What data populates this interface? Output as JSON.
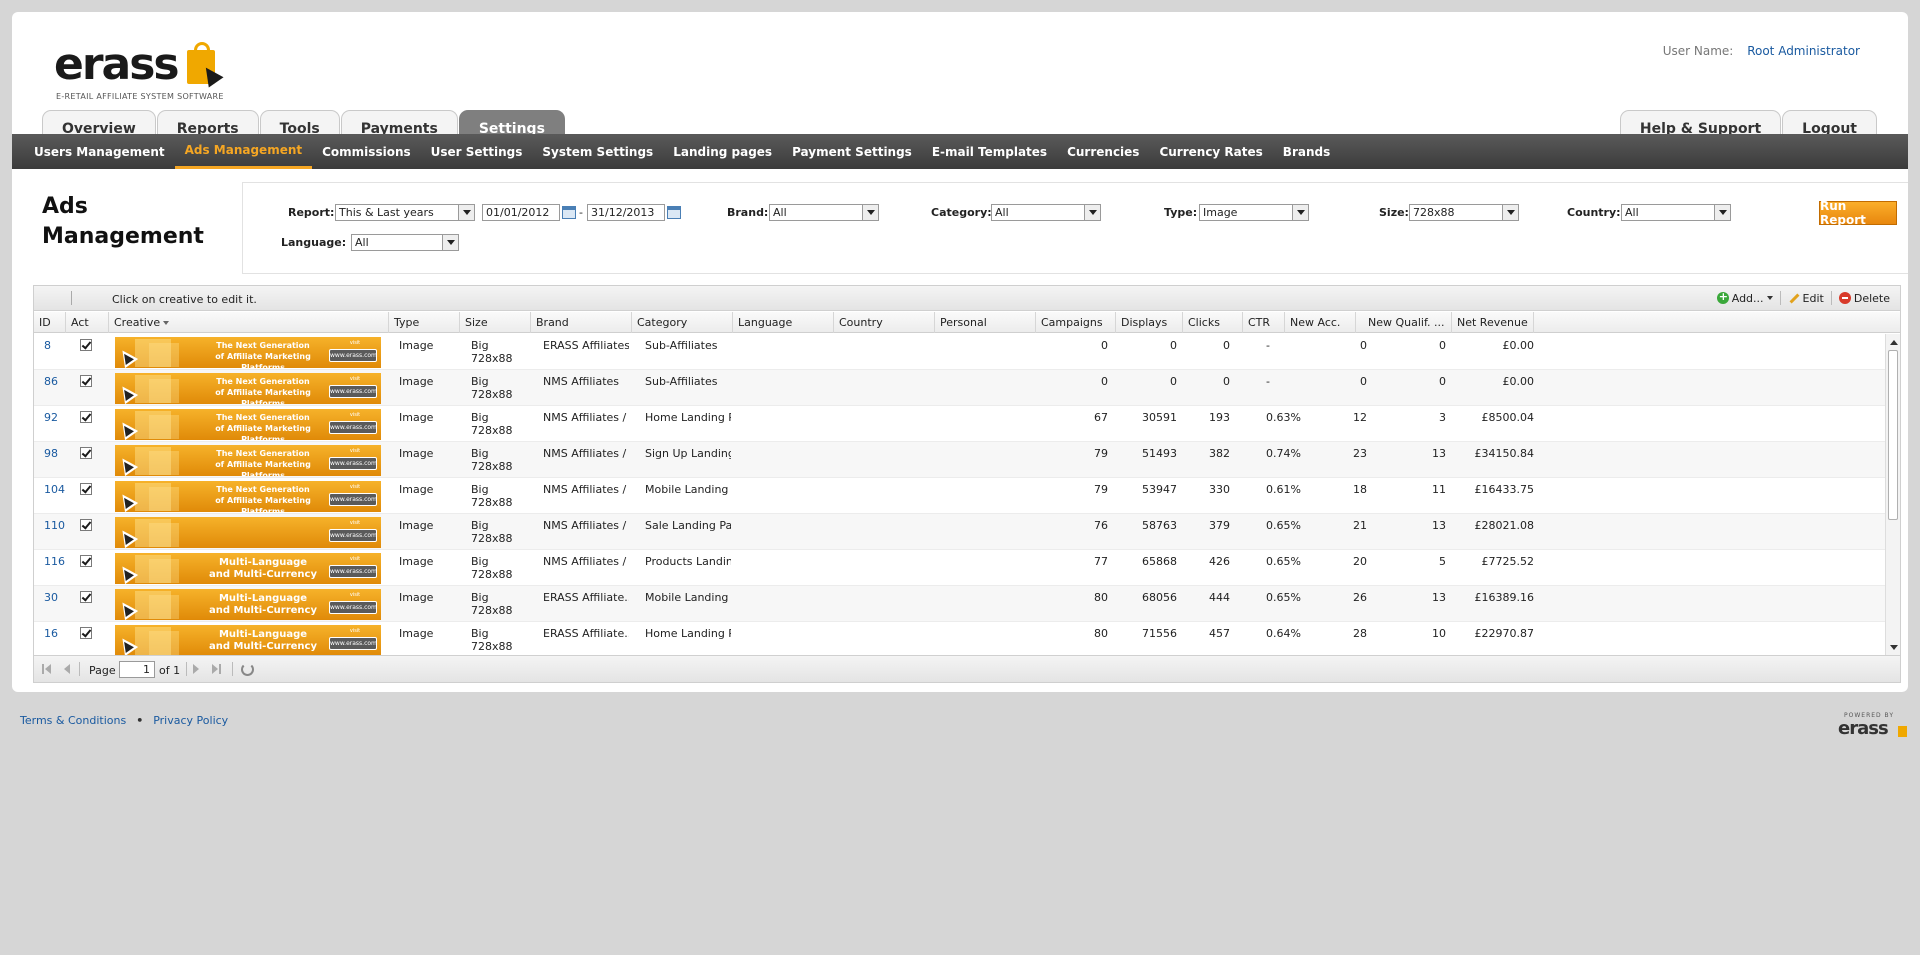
{
  "header": {
    "logo_text": "erass",
    "logo_tagline": "E-RETAIL AFFILIATE SYSTEM SOFTWARE",
    "user_label": "User Name:",
    "user_value": "Root Administrator"
  },
  "main_tabs": [
    {
      "label": "Overview",
      "active": false
    },
    {
      "label": "Reports",
      "active": false
    },
    {
      "label": "Tools",
      "active": false
    },
    {
      "label": "Payments",
      "active": false
    },
    {
      "label": "Settings",
      "active": true
    }
  ],
  "right_tabs": [
    {
      "label": "Help & Support"
    },
    {
      "label": "Logout"
    }
  ],
  "subnav": [
    {
      "label": "Users Management",
      "active": false
    },
    {
      "label": "Ads Management",
      "active": true
    },
    {
      "label": "Commissions",
      "active": false
    },
    {
      "label": "User Settings",
      "active": false
    },
    {
      "label": "System Settings",
      "active": false
    },
    {
      "label": "Landing pages",
      "active": false
    },
    {
      "label": "Payment Settings",
      "active": false
    },
    {
      "label": "E-mail Templates",
      "active": false
    },
    {
      "label": "Currencies",
      "active": false
    },
    {
      "label": "Currency Rates",
      "active": false
    },
    {
      "label": "Brands",
      "active": false
    }
  ],
  "page_title_line1": "Ads",
  "page_title_line2": "Management",
  "filters": {
    "report_label": "Report:",
    "report_value": "This & Last years",
    "date_from": "01/01/2012",
    "date_sep": "-",
    "date_to": "31/12/2013",
    "brand_label": "Brand:",
    "brand_value": "All",
    "category_label": "Category:",
    "category_value": "All",
    "type_label": "Type:",
    "type_value": "Image",
    "size_label": "Size:",
    "size_value": "728x88",
    "country_label": "Country:",
    "country_value": "All",
    "language_label": "Language:",
    "language_value": "All",
    "run_label": "Run Report"
  },
  "grid": {
    "hint": "Click on creative to edit it.",
    "actions": {
      "add": "Add...",
      "edit": "Edit",
      "delete": "Delete"
    },
    "columns": [
      "ID",
      "Act",
      "Creative",
      "Type",
      "Size",
      "Brand",
      "Category",
      "Language",
      "Country",
      "Personal",
      "Campaigns",
      "Displays",
      "Clicks",
      "CTR",
      "New Acc.",
      "New Qualif. ...",
      "Net Revenue"
    ],
    "banner_texts": {
      "next_gen_1": "The Next Generation",
      "next_gen_2": "of Affiliate Marketing Platforms",
      "multi_1": "Multi-Language",
      "multi_2": "and Multi-Currency",
      "visit": "visit",
      "url": "www.erass.com"
    },
    "rows": [
      {
        "id": "8",
        "banner": "next_gen",
        "type": "Image",
        "size1": "Big",
        "size2": "728x88",
        "brand": "ERASS Affiliates",
        "category": "Sub-Affiliates",
        "campaigns": "0",
        "displays": "0",
        "clicks": "0",
        "ctr": "-",
        "new_acc": "0",
        "new_qualif": "0",
        "net_revenue": "£0.00"
      },
      {
        "id": "86",
        "banner": "next_gen",
        "type": "Image",
        "size1": "Big",
        "size2": "728x88",
        "brand": "NMS Affiliates",
        "category": "Sub-Affiliates",
        "campaigns": "0",
        "displays": "0",
        "clicks": "0",
        "ctr": "-",
        "new_acc": "0",
        "new_qualif": "0",
        "net_revenue": "£0.00"
      },
      {
        "id": "92",
        "banner": "next_gen",
        "type": "Image",
        "size1": "Big",
        "size2": "728x88",
        "brand": "NMS Affiliates / ...",
        "category": "Home Landing P...",
        "campaigns": "67",
        "displays": "30591",
        "clicks": "193",
        "ctr": "0.63%",
        "new_acc": "12",
        "new_qualif": "3",
        "net_revenue": "£8500.04"
      },
      {
        "id": "98",
        "banner": "next_gen",
        "type": "Image",
        "size1": "Big",
        "size2": "728x88",
        "brand": "NMS Affiliates / ...",
        "category": "Sign Up Landing...",
        "campaigns": "79",
        "displays": "51493",
        "clicks": "382",
        "ctr": "0.74%",
        "new_acc": "23",
        "new_qualif": "13",
        "net_revenue": "£34150.84"
      },
      {
        "id": "104",
        "banner": "next_gen",
        "type": "Image",
        "size1": "Big",
        "size2": "728x88",
        "brand": "NMS Affiliates / ...",
        "category": "Mobile Landing P...",
        "campaigns": "79",
        "displays": "53947",
        "clicks": "330",
        "ctr": "0.61%",
        "new_acc": "18",
        "new_qualif": "11",
        "net_revenue": "£16433.75"
      },
      {
        "id": "110",
        "banner": "plain",
        "type": "Image",
        "size1": "Big",
        "size2": "728x88",
        "brand": "NMS Affiliates / ...",
        "category": "Sale Landing Page",
        "campaigns": "76",
        "displays": "58763",
        "clicks": "379",
        "ctr": "0.65%",
        "new_acc": "21",
        "new_qualif": "13",
        "net_revenue": "£28021.08"
      },
      {
        "id": "116",
        "banner": "multi",
        "type": "Image",
        "size1": "Big",
        "size2": "728x88",
        "brand": "NMS Affiliates / ...",
        "category": "Products Landin...",
        "campaigns": "77",
        "displays": "65868",
        "clicks": "426",
        "ctr": "0.65%",
        "new_acc": "20",
        "new_qualif": "5",
        "net_revenue": "£7725.52"
      },
      {
        "id": "30",
        "banner": "multi",
        "type": "Image",
        "size1": "Big",
        "size2": "728x88",
        "brand": "ERASS Affiliate...",
        "category": "Mobile Landing P...",
        "campaigns": "80",
        "displays": "68056",
        "clicks": "444",
        "ctr": "0.65%",
        "new_acc": "26",
        "new_qualif": "13",
        "net_revenue": "£16389.16"
      },
      {
        "id": "16",
        "banner": "multi",
        "type": "Image",
        "size1": "Big",
        "size2": "728x88",
        "brand": "ERASS Affiliate...",
        "category": "Home Landing P...",
        "campaigns": "80",
        "displays": "71556",
        "clicks": "457",
        "ctr": "0.64%",
        "new_acc": "28",
        "new_qualif": "10",
        "net_revenue": "£22970.87"
      }
    ]
  },
  "pager": {
    "page_label": "Page",
    "page_value": "1",
    "of_label": "of 1"
  },
  "footer": {
    "terms": "Terms & Conditions",
    "bullet": "•",
    "privacy": "Privacy Policy",
    "powered_label": "POWERED BY",
    "powered_word": "erass"
  }
}
